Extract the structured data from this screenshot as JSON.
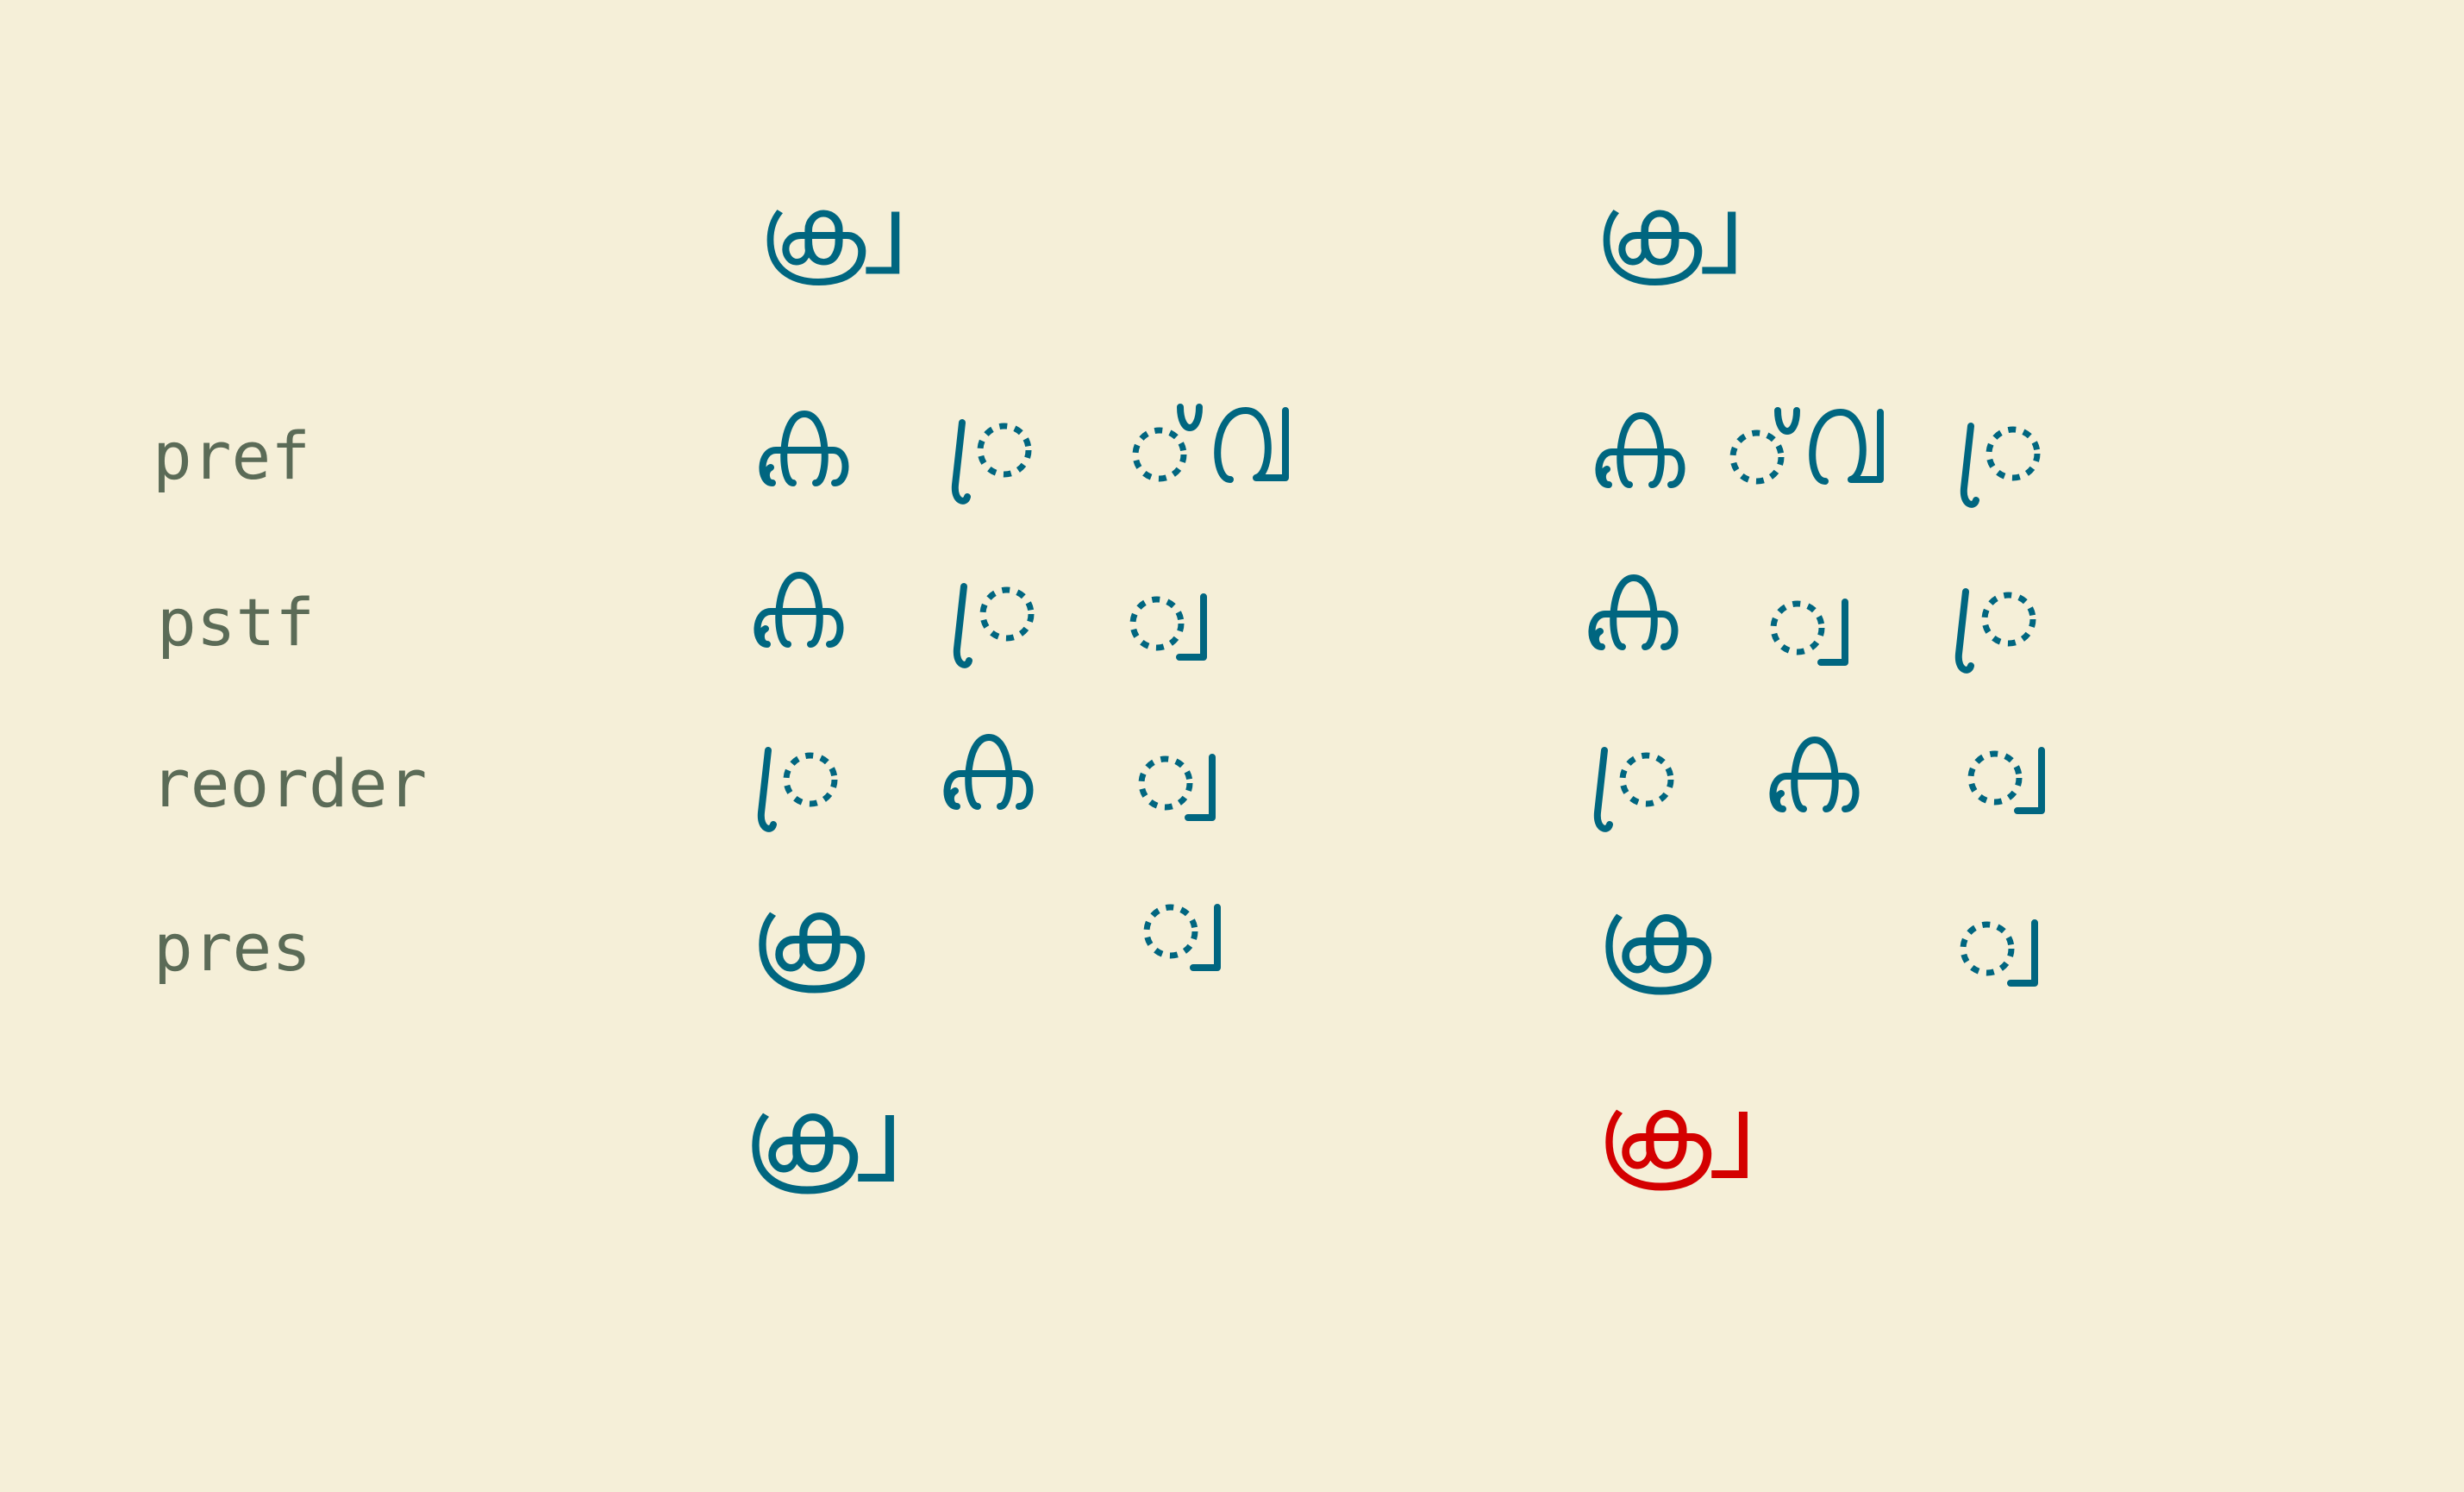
{
  "titles": {
    "left": "ക്ര്വ",
    "right": "ക്വ്ര"
  },
  "rows": [
    {
      "label": "pref",
      "left": [
        "ക",
        "്ര",
        "്വ"
      ],
      "right": [
        "ക",
        "്വ",
        "്ര"
      ]
    },
    {
      "label": "pstf",
      "left": [
        "ക",
        "്ര",
        "്വ"
      ],
      "right": [
        "ക",
        "്വ",
        "്ര"
      ]
    },
    {
      "label": "reorder",
      "left": [
        "്ര",
        "ക",
        "്വ"
      ],
      "right": [
        "്ര",
        "ക",
        "്വ"
      ]
    },
    {
      "label": "pres",
      "left": [
        "ക്ര",
        "്വ"
      ],
      "right": [
        "ക്ര",
        "്വ"
      ]
    }
  ],
  "results": {
    "left": "ക്ര്വ",
    "right": "ക്വ്ര"
  },
  "colors": {
    "background": "#f5efd8",
    "glyph": "#006680",
    "error": "#d40000",
    "label": "#5b6b57"
  }
}
